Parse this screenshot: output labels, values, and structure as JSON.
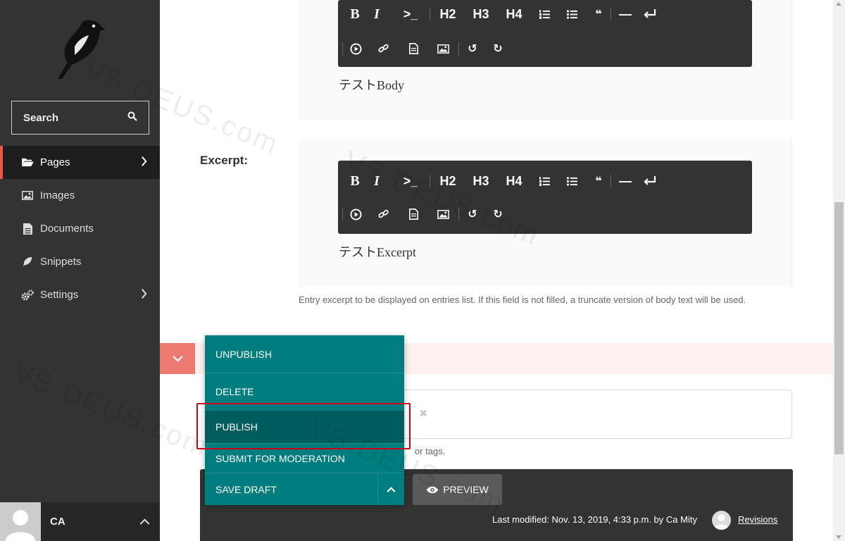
{
  "sidebar": {
    "search_label": "Search",
    "items": [
      {
        "label": "Pages",
        "icon": "folder-open-icon",
        "active": true,
        "has_children": true
      },
      {
        "label": "Images",
        "icon": "image-icon",
        "active": false,
        "has_children": false
      },
      {
        "label": "Documents",
        "icon": "document-icon",
        "active": false,
        "has_children": false
      },
      {
        "label": "Snippets",
        "icon": "snippet-icon",
        "active": false,
        "has_children": false
      },
      {
        "label": "Settings",
        "icon": "cogs-icon",
        "active": false,
        "has_children": true
      }
    ],
    "account_initials": "CA"
  },
  "editor": {
    "toolbar_row1": [
      "B",
      "I",
      ">_",
      "H2",
      "H3",
      "H4",
      "ordered-list-icon",
      "bullet-list-icon",
      "quote-icon",
      "—",
      "line-break-icon"
    ],
    "toolbar_row2": [
      "embed-icon",
      "link-icon",
      "document-icon",
      "image-icon",
      "undo-icon",
      "redo-icon"
    ],
    "body_text": "テストBody",
    "excerpt_label": "Excerpt:",
    "excerpt_text": "テストExcerpt",
    "excerpt_help": "Entry excerpt to be displayed on entries list. If this field is not filled, a truncate version of body text will be used.",
    "tags_help_partial": "or tags.",
    "tag_remove": "✖"
  },
  "publish_menu": {
    "items": [
      "UNPUBLISH",
      "DELETE",
      "PUBLISH",
      "SUBMIT FOR MODERATION",
      "SAVE DRAFT"
    ],
    "highlighted": "PUBLISH"
  },
  "footer": {
    "preview_label": "PREVIEW",
    "last_modified": "Last modified: Nov. 13, 2019, 4:33 p.m. by Ca Mity",
    "revisions_label": "Revisions"
  },
  "watermark": "VS DEUS.com",
  "colors": {
    "sidebar_bg": "#333333",
    "accent": "#e9584d",
    "teal": "#007d7e",
    "teal_dark": "#005d5f",
    "highlight": "#d0021b"
  }
}
